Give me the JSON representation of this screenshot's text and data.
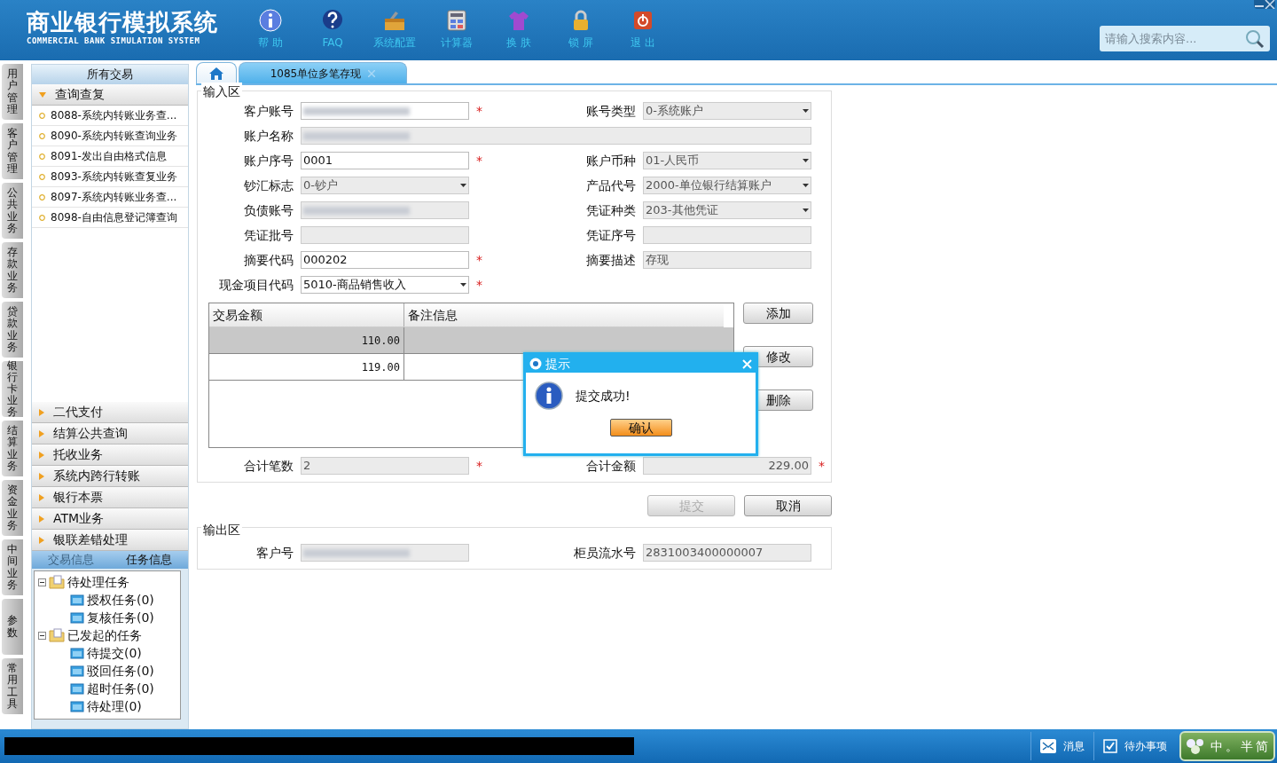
{
  "header": {
    "title": "商业银行模拟系统",
    "subtitle": "COMMERCIAL BANK SIMULATION SYSTEM",
    "tools": [
      {
        "label": "帮 助",
        "kind": "info"
      },
      {
        "label": "FAQ",
        "kind": "question"
      },
      {
        "label": "系统配置",
        "kind": "toolbox"
      },
      {
        "label": "计算器",
        "kind": "calculator"
      },
      {
        "label": "换 肤",
        "kind": "shirt"
      },
      {
        "label": "锁 屏",
        "kind": "lock"
      },
      {
        "label": "退 出",
        "kind": "power"
      }
    ],
    "search": {
      "placeholder": "请输入搜索内容..."
    }
  },
  "left_tabs": [
    "用户管理",
    "客户管理",
    "公共业务",
    "存款业务",
    "贷款业务",
    "银行卡业务",
    "结算业务",
    "资金业务",
    "中间业务",
    "参数",
    "常用工具"
  ],
  "sidebar": {
    "title": "所有交易",
    "groups": [
      {
        "label": "查询查复",
        "expanded": true,
        "items": [
          "8088-系统内转账业务查...",
          "8090-系统内转账查询业务",
          "8091-发出自由格式信息",
          "8093-系统内转账查复业务",
          "8097-系统内转账业务查...",
          "8098-自由信息登记簿查询"
        ]
      },
      {
        "label": "二代支付",
        "expanded": false
      },
      {
        "label": "结算公共查询",
        "expanded": false
      },
      {
        "label": "托收业务",
        "expanded": false
      },
      {
        "label": "系统内跨行转账",
        "expanded": false
      },
      {
        "label": "银行本票",
        "expanded": false
      },
      {
        "label": "ATM业务",
        "expanded": false
      },
      {
        "label": "银联差错处理",
        "expanded": false
      }
    ]
  },
  "task_panel": {
    "tabs": [
      {
        "label": "交易信息",
        "selected": false
      },
      {
        "label": "任务信息",
        "selected": true
      }
    ],
    "tree": [
      {
        "label": "待处理任务",
        "expanded": true,
        "children": [
          {
            "label": "授权任务(0)"
          },
          {
            "label": "复核任务(0)"
          }
        ]
      },
      {
        "label": "已发起的任务",
        "expanded": true,
        "children": [
          {
            "label": "待提交(0)"
          },
          {
            "label": "驳回任务(0)"
          },
          {
            "label": "超时任务(0)"
          },
          {
            "label": "待处理(0)"
          }
        ]
      }
    ]
  },
  "tabs": [
    {
      "kind": "home",
      "selected": false
    },
    {
      "kind": "page",
      "label": "1085单位多笔存现",
      "selected": true
    }
  ],
  "input_section": {
    "title": "输入区",
    "rows": [
      [
        {
          "label": "客户账号",
          "kind": "text",
          "blurred": true,
          "disabled": false,
          "required_mark": "*"
        },
        {
          "label": "账号类型",
          "kind": "select",
          "value": "0-系统账户",
          "disabled": true
        }
      ],
      [
        {
          "label": "账户名称",
          "kind": "wide",
          "blurred": true,
          "disabled": true
        }
      ],
      [
        {
          "label": "账户序号",
          "kind": "text",
          "value": "0001",
          "disabled": false,
          "required_mark": "*"
        },
        {
          "label": "账户币种",
          "kind": "select",
          "value": "01-人民币",
          "disabled": true
        }
      ],
      [
        {
          "label": "钞汇标志",
          "kind": "select",
          "value": "0-钞户",
          "disabled": true
        },
        {
          "label": "产品代号",
          "kind": "select",
          "value": "2000-单位银行结算账户",
          "disabled": true
        }
      ],
      [
        {
          "label": "负债账号",
          "kind": "text",
          "blurred": true,
          "disabled": true
        },
        {
          "label": "凭证种类",
          "kind": "select",
          "value": "203-其他凭证",
          "disabled": true
        }
      ],
      [
        {
          "label": "凭证批号",
          "kind": "text",
          "disabled": true
        },
        {
          "label": "凭证序号",
          "kind": "text",
          "disabled": true
        }
      ],
      [
        {
          "label": "摘要代码",
          "kind": "text",
          "value": "000202",
          "disabled": false,
          "required_mark": "*"
        },
        {
          "label": "摘要描述",
          "kind": "text",
          "value": "存现",
          "disabled": true
        }
      ],
      [
        {
          "label": "现金项目代码",
          "kind": "select",
          "value": "5010-商品销售收入",
          "disabled": false,
          "required_mark": "*"
        }
      ]
    ],
    "grid": {
      "columns": [
        "交易金额",
        "备注信息"
      ],
      "rows": [
        {
          "amount": "110.00",
          "selected": true
        },
        {
          "amount": "119.00",
          "selected": false
        }
      ]
    },
    "grid_buttons": [
      "添加",
      "修改",
      "删除"
    ],
    "totals": [
      {
        "label": "合计笔数",
        "kind": "text",
        "value": "2",
        "disabled": true,
        "required_mark": "*"
      },
      {
        "label": "合计金额",
        "kind": "number",
        "value": "229.00",
        "disabled": true,
        "required_mark": "*"
      }
    ]
  },
  "actions": [
    {
      "label": "提交",
      "disabled": true
    },
    {
      "label": "取消",
      "disabled": false
    }
  ],
  "output_section": {
    "title": "输出区",
    "rows": [
      [
        {
          "label": "客户号",
          "kind": "text",
          "blurred": true,
          "disabled": true
        },
        {
          "label": "柜员流水号",
          "kind": "text",
          "value": "2831003400000007",
          "disabled": true
        }
      ]
    ]
  },
  "dialog": {
    "title": "提示",
    "message": "提交成功!",
    "button": "确认"
  },
  "status_bar": {
    "items": [
      {
        "label": "消息",
        "kind": "mail"
      },
      {
        "label": "待办事项",
        "kind": "check"
      }
    ],
    "ime": [
      "中",
      "。",
      "半",
      "简"
    ]
  }
}
